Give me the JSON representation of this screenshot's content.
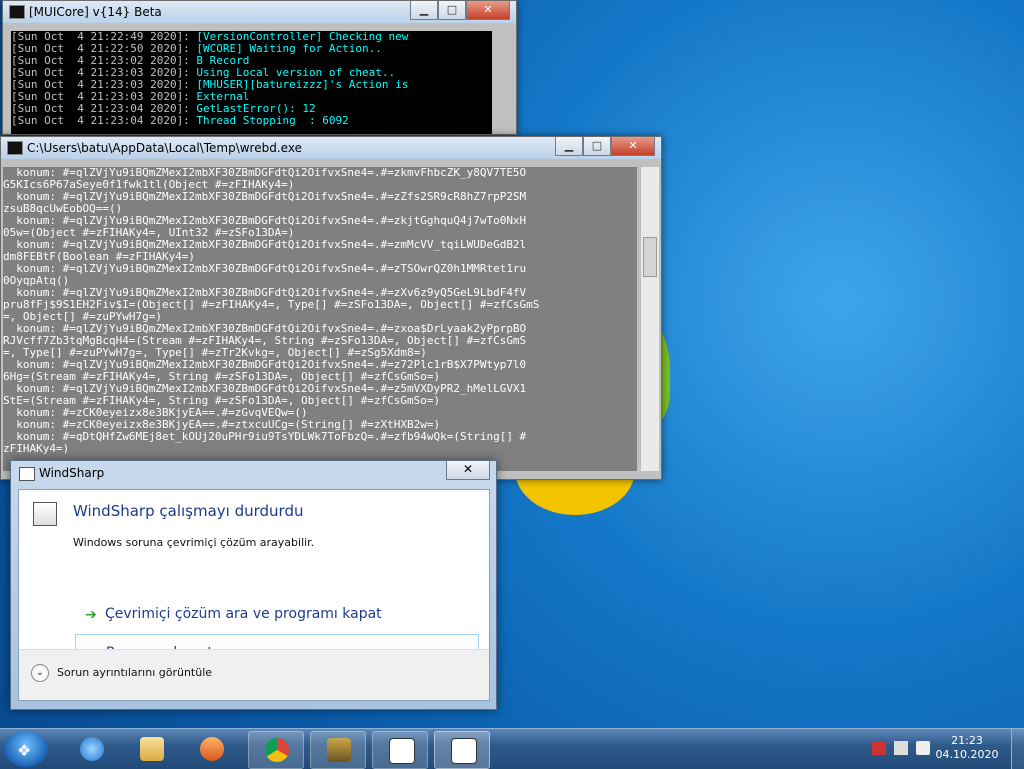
{
  "console1": {
    "title": "[MUICore] v{14} Beta",
    "lines": [
      {
        "ts": "[Sun Oct  4 21:22:49 2020]:",
        "msg": " [VersionController] Checking new"
      },
      {
        "ts": "[Sun Oct  4 21:22:50 2020]:",
        "msg": " [WCORE] Waiting for Action.."
      },
      {
        "ts": "[Sun Oct  4 21:23:02 2020]:",
        "msg": " B Record"
      },
      {
        "ts": "[Sun Oct  4 21:23:03 2020]:",
        "msg": " Using Local version of cheat.."
      },
      {
        "ts": "[Sun Oct  4 21:23:03 2020]:",
        "msg": " [MHUSER][batureizzz]'s Action is"
      },
      {
        "ts": "[Sun Oct  4 21:23:03 2020]:",
        "msg": " External"
      },
      {
        "ts": "[Sun Oct  4 21:23:04 2020]:",
        "msg": " GetLastError(): 12"
      },
      {
        "ts": "[Sun Oct  4 21:23:04 2020]:",
        "msg": " Thread Stopping  : 6092"
      }
    ]
  },
  "console2": {
    "title": "C:\\Users\\batu\\AppData\\Local\\Temp\\wrebd.exe",
    "lines": [
      "  konum: #=qlZVjYu9iBQmZMexI2mbXF30ZBmDGFdtQi2OifvxSne4=.#=zkmvFhbcZK_y8QV7TE5O",
      "G5KIcs6P67aSeye0f1fwk1tl(Object #=zFIHAKy4=)",
      "  konum: #=qlZVjYu9iBQmZMexI2mbXF30ZBmDGFdtQi2OifvxSne4=.#=zZfs2SR9cR8hZ7rpP2SM",
      "zsuB8qcUwEobOQ==()",
      "  konum: #=qlZVjYu9iBQmZMexI2mbXF30ZBmDGFdtQi2OifvxSne4=.#=zkjtGghquQ4j7wTo0NxH",
      "05w=(Object #=zFIHAKy4=, UInt32 #=zSFo13DA=)",
      "  konum: #=qlZVjYu9iBQmZMexI2mbXF30ZBmDGFdtQi2OifvxSne4=.#=zmMcVV_tqiLWUDeGdB2l",
      "dm8FEBtF(Boolean #=zFIHAKy4=)",
      "  konum: #=qlZVjYu9iBQmZMexI2mbXF30ZBmDGFdtQi2OifvxSne4=.#=zTSOwrQZ0h1MMRtet1ru",
      "0OyqpAtq()",
      "  konum: #=qlZVjYu9iBQmZMexI2mbXF30ZBmDGFdtQi2OifvxSne4=.#=zXv6z9yQ5GeL9LbdF4fV",
      "pru8fFj$9S1EH2Fiv$I=(Object[] #=zFIHAKy4=, Type[] #=zSFo13DA=, Object[] #=zfCsGmS",
      "=, Object[] #=zuPYwH7g=)",
      "  konum: #=qlZVjYu9iBQmZMexI2mbXF30ZBmDGFdtQi2OifvxSne4=.#=zxoa$DrLyaak2yPprpBO",
      "RJVcff7Zb3tqMgBcqH4=(Stream #=zFIHAKy4=, String #=zSFo13DA=, Object[] #=zfCsGmS",
      "=, Type[] #=zuPYwH7g=, Type[] #=zTr2Kvkg=, Object[] #=zSg5Xdm8=)",
      "  konum: #=qlZVjYu9iBQmZMexI2mbXF30ZBmDGFdtQi2OifvxSne4=.#=z72Plc1rB$X7PWtyp7l0",
      "6Hg=(Stream #=zFIHAKy4=, String #=zSFo13DA=, Object[] #=zfCsGmSo=)",
      "  konum: #=qlZVjYu9iBQmZMexI2mbXF30ZBmDGFdtQi2OifvxSne4=.#=z5mVXDyPR2_hMelLGVX1",
      "StE=(Stream #=zFIHAKy4=, String #=zSFo13DA=, Object[] #=zfCsGmSo=)",
      "  konum: #=zCK0eyeizx8e3BKjyEA==.#=zGvqVEQw=()",
      "  konum: #=zCK0eyeizx8e3BKjyEA==.#=ztxcuUCg=(String[] #=zXtHXB2w=)",
      "  konum: #=qDtQHfZw6MEj8et_kOUj20uPHr9iu9TsYDLWk7ToFbzQ=.#=zfb94wQk=(String[] #",
      "zFIHAKy4=)"
    ]
  },
  "dialog": {
    "title": "WindSharp",
    "heading": "WindSharp çalışmayı durdurdu",
    "subtext": "Windows soruna çevrimiçi çözüm arayabilir.",
    "option1": "Çevrimiçi çözüm ara ve programı kapat",
    "option2": "Programı kapat",
    "details": "Sorun ayrıntılarını görüntüle"
  },
  "taskbar": {
    "time": "21:23",
    "date": "04.10.2020"
  },
  "colors": {
    "console_text": "#00ffff",
    "desktop": "#1478c8"
  }
}
